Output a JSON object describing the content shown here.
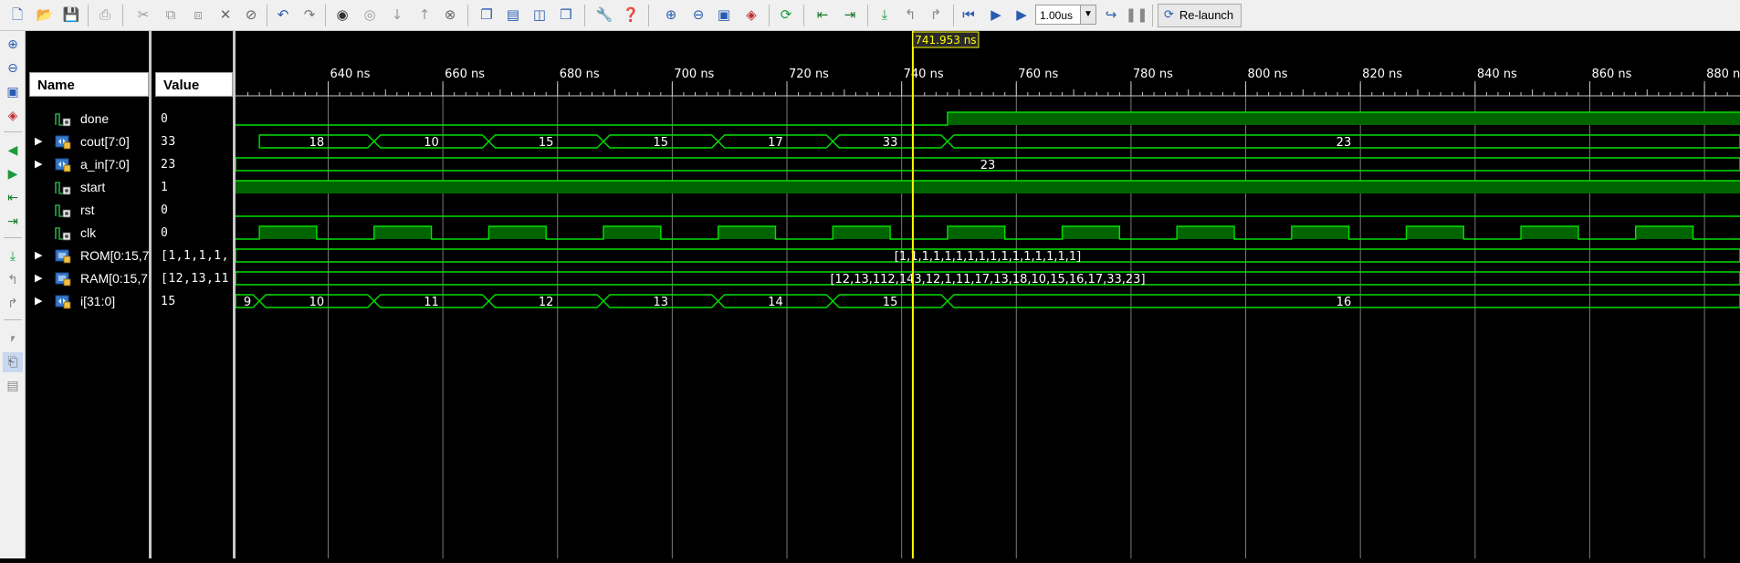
{
  "toolbar": {
    "zoom_value": "1.00us",
    "relaunch_label": "Re-launch"
  },
  "columns": {
    "name_header": "Name",
    "value_header": "Value"
  },
  "signals": [
    {
      "name": "done",
      "value": "0",
      "expandable": false,
      "icon": "scalar-signal-icon"
    },
    {
      "name": "cout[7:0]",
      "value": "33",
      "expandable": true,
      "icon": "bus-signal-icon"
    },
    {
      "name": "a_in[7:0]",
      "value": "23",
      "expandable": true,
      "icon": "bus-signal-icon"
    },
    {
      "name": "start",
      "value": "1",
      "expandable": false,
      "icon": "scalar-signal-icon"
    },
    {
      "name": "rst",
      "value": "0",
      "expandable": false,
      "icon": "scalar-signal-icon"
    },
    {
      "name": "clk",
      "value": "0",
      "expandable": false,
      "icon": "scalar-signal-icon"
    },
    {
      "name": "ROM[0:15,7",
      "value": "[1,1,1,1,",
      "expandable": true,
      "icon": "array-signal-icon"
    },
    {
      "name": "RAM[0:15,7:",
      "value": "[12,13,11",
      "expandable": true,
      "icon": "array-signal-icon"
    },
    {
      "name": "i[31:0]",
      "value": "15",
      "expandable": true,
      "icon": "bus-signal-icon"
    }
  ],
  "time_axis": {
    "unit": "ns",
    "view_start_ns": 624.8,
    "view_end_ns": 885.4,
    "major_ticks": [
      640,
      660,
      680,
      700,
      720,
      740,
      760,
      780,
      800,
      820,
      840,
      860,
      880
    ],
    "tick_labels": [
      "640 ns",
      "660 ns",
      "680 ns",
      "700 ns",
      "720 ns",
      "740 ns",
      "760 ns",
      "780 ns",
      "800 ns",
      "820 ns",
      "840 ns",
      "860 ns",
      "880 ns"
    ],
    "minor_step_ns": 2
  },
  "cursor": {
    "time_ns": 741.953,
    "label": "741.953 ns"
  },
  "waveforms": {
    "clk_edges_ns": [
      628,
      638,
      648,
      658,
      668,
      678,
      688,
      698,
      708,
      718,
      728,
      738,
      748,
      758,
      768,
      778,
      788,
      798,
      808,
      818,
      828,
      838,
      848,
      858,
      868,
      878
    ],
    "clk_first_level": 1,
    "done_rise_ns": 748,
    "start_level": 1,
    "rst_level": 0,
    "cout": {
      "transitions_ns": [
        628,
        648,
        668,
        688,
        708,
        728,
        748
      ],
      "values": [
        "18",
        "10",
        "15",
        "15",
        "17",
        "33",
        "23"
      ]
    },
    "a_in": {
      "value": "23"
    },
    "rom": {
      "value": "[1,1,1,1,1,1,1,1,1,1,1,1,1,1,1,1]"
    },
    "ram": {
      "value": "[12,13,112,143,12,1,11,17,13,18,10,15,16,17,33,23]"
    },
    "i": {
      "transitions_ns": [
        628,
        648,
        668,
        688,
        708,
        728,
        748
      ],
      "values": [
        "9",
        "10",
        "11",
        "12",
        "13",
        "14",
        "15",
        "16"
      ]
    }
  },
  "colors": {
    "wave": "#00e000",
    "wave_fill": "#006400",
    "cursor": "#ffff00",
    "grid": "#7a7a7a",
    "background": "#000000"
  }
}
